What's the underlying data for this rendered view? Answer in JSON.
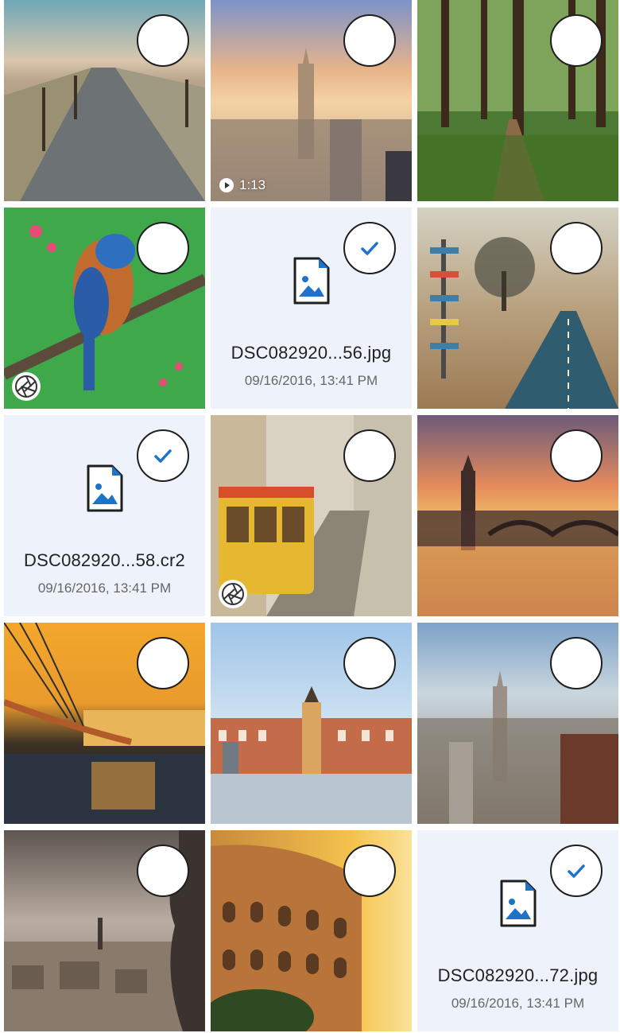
{
  "tiles": [
    {
      "kind": "photo",
      "scene": "boardwalk",
      "selected": false
    },
    {
      "kind": "video",
      "scene": "new-york-tower",
      "selected": false,
      "duration": "1:13"
    },
    {
      "kind": "photo",
      "scene": "forest-path",
      "selected": false
    },
    {
      "kind": "photo",
      "scene": "bluebird",
      "selected": false,
      "burst": true
    },
    {
      "kind": "file",
      "name": "DSC082920...56.jpg",
      "date": "09/16/2016, 13:41 PM",
      "selected": true
    },
    {
      "kind": "photo",
      "scene": "signpost-road",
      "selected": false
    },
    {
      "kind": "file",
      "name": "DSC082920...58.cr2",
      "date": "09/16/2016, 13:41 PM",
      "selected": true
    },
    {
      "kind": "photo",
      "scene": "tram",
      "selected": false,
      "burst": true
    },
    {
      "kind": "photo",
      "scene": "london-sunset",
      "selected": false
    },
    {
      "kind": "photo",
      "scene": "bridge-river",
      "selected": false
    },
    {
      "kind": "photo",
      "scene": "plaza-statue",
      "selected": false
    },
    {
      "kind": "photo",
      "scene": "skyline",
      "selected": false
    },
    {
      "kind": "photo",
      "scene": "paris-gargoyle",
      "selected": false
    },
    {
      "kind": "photo",
      "scene": "colosseum",
      "selected": false
    },
    {
      "kind": "file",
      "name": "DSC082920...72.jpg",
      "date": "09/16/2016, 13:41 PM",
      "selected": true
    }
  ],
  "colors": {
    "accent": "#1f72c9",
    "tile_bg": "#eef3fb",
    "check": "#1f72c9"
  }
}
